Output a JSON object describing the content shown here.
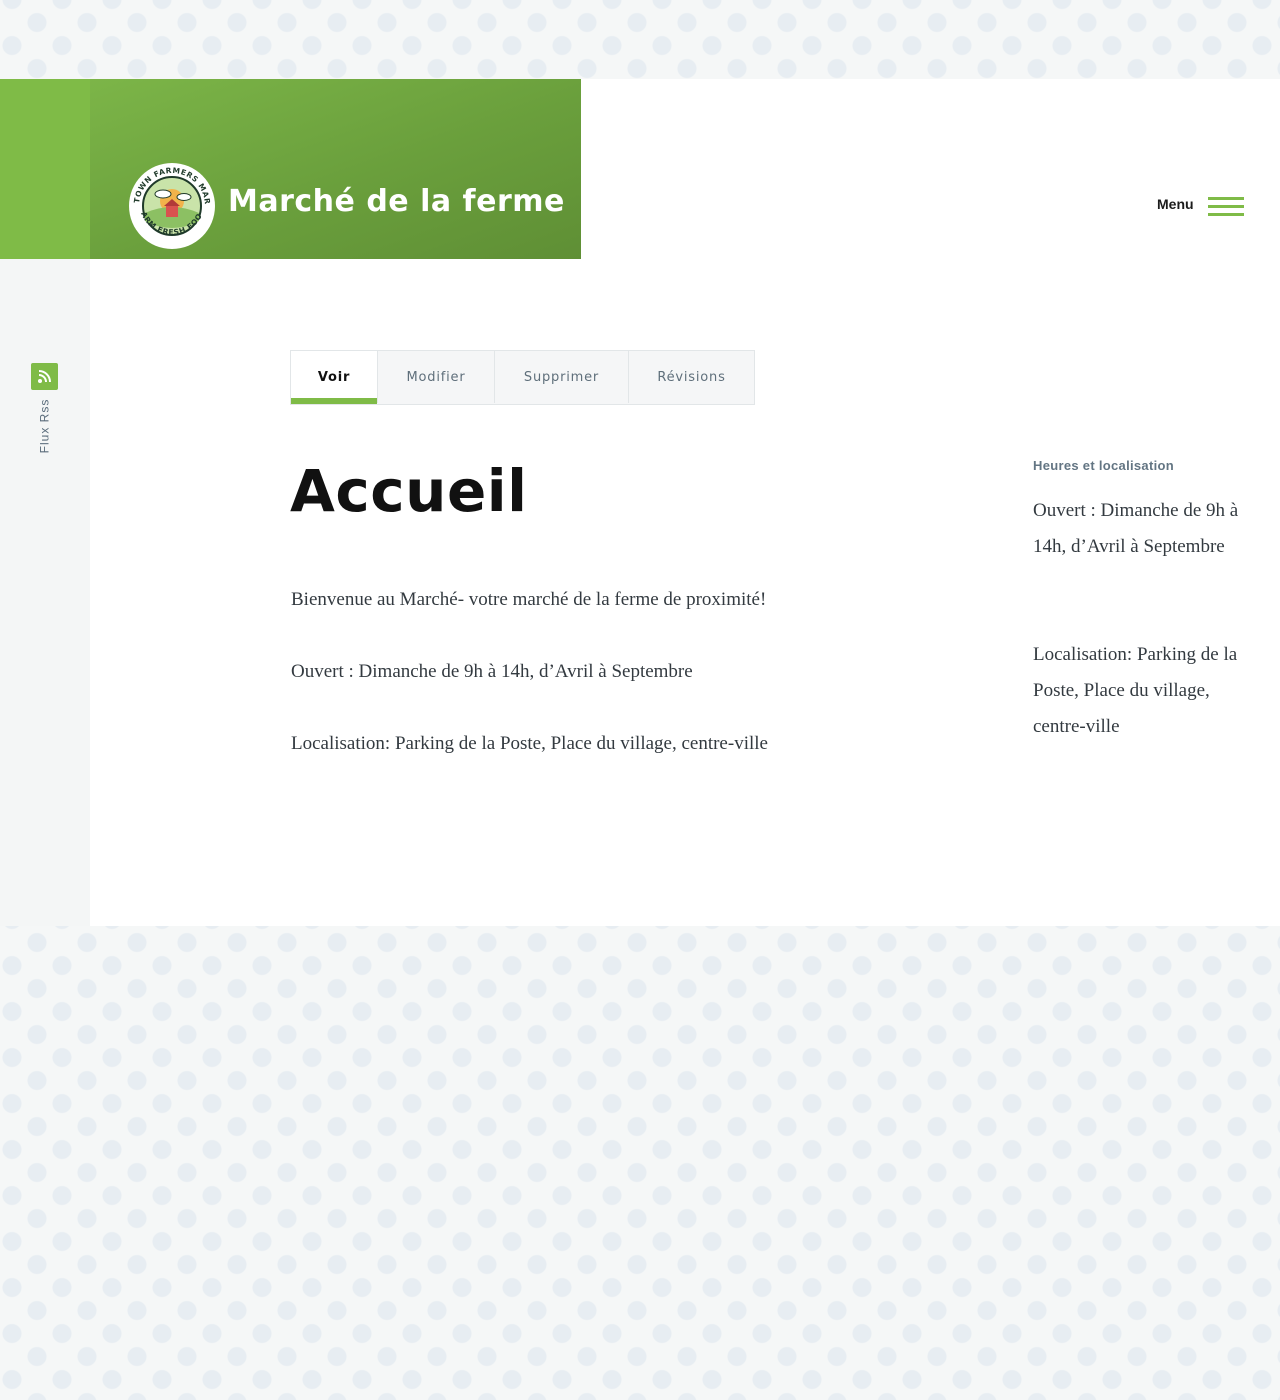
{
  "colors": {
    "accent": "#7fbb47",
    "text": "#333a40",
    "title": "#111111"
  },
  "site": {
    "name": "Marché de la ferme",
    "logo_top_text": "ANYTOWN FARMERS MARKET",
    "logo_bottom_text": "FARM FRESH FOOD"
  },
  "menu": {
    "label": "Menu",
    "icon": "hamburger-icon"
  },
  "rss": {
    "label": "Flux Rss",
    "icon": "rss-icon"
  },
  "tabs": [
    {
      "label": "Voir",
      "active": true
    },
    {
      "label": "Modifier",
      "active": false
    },
    {
      "label": "Supprimer",
      "active": false
    },
    {
      "label": "Révisions",
      "active": false
    }
  ],
  "page": {
    "title": "Accueil",
    "paragraphs": [
      "Bienvenue au Marché- votre marché de la ferme de proximité!",
      "Ouvert : Dimanche de 9h à 14h, d’Avril à Septembre",
      "Localisation: Parking de la Poste, Place du village, centre-ville"
    ]
  },
  "sidebar": {
    "heading": "Heures et localisation",
    "hours": "Ouvert : Dimanche de 9h à 14h, d’Avril à Septembre",
    "location": "Localisation: Parking de la Poste, Place du village, centre-ville"
  }
}
